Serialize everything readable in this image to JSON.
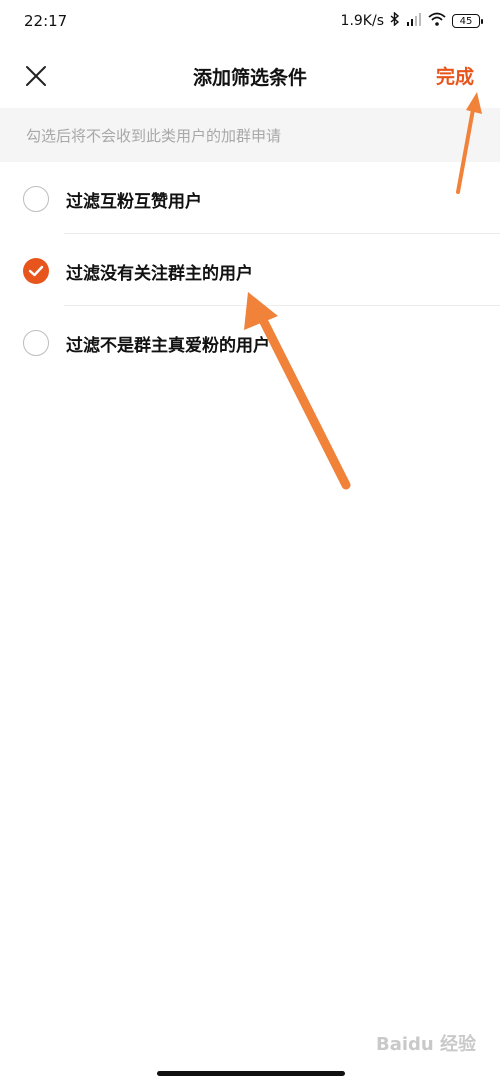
{
  "status_bar": {
    "time": "22:17",
    "net_speed": "1.9K/s",
    "battery": "45"
  },
  "nav": {
    "title": "添加筛选条件",
    "done_label": "完成",
    "accent_color": "#e8551c"
  },
  "hint": "勾选后将不会收到此类用户的加群申请",
  "options": [
    {
      "label": "过滤互粉互赞用户",
      "checked": false
    },
    {
      "label": "过滤没有关注群主的用户",
      "checked": true
    },
    {
      "label": "过滤不是群主真爱粉的用户",
      "checked": false
    }
  ],
  "watermark": "Baidu 经验"
}
